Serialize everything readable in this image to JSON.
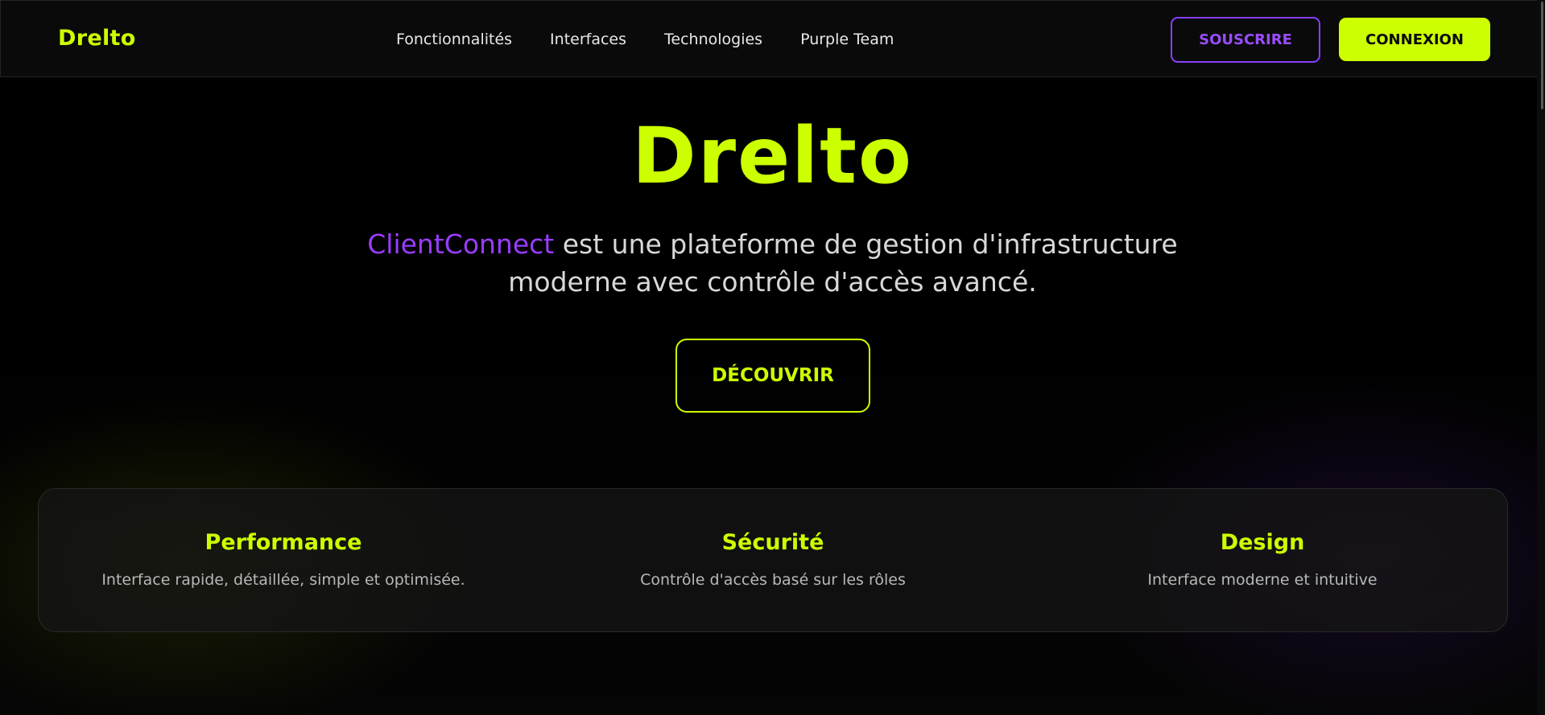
{
  "header": {
    "logo": "Drelto",
    "nav": [
      "Fonctionnalités",
      "Interfaces",
      "Technologies",
      "Purple Team"
    ],
    "subscribe_label": "SOUSCRIRE",
    "login_label": "CONNEXION"
  },
  "hero": {
    "title": "Drelto",
    "brand": "ClientConnect",
    "tagline": " est une plateforme de gestion d'infrastructure moderne avec contrôle d'accès avancé.",
    "cta_label": "DÉCOUVRIR"
  },
  "features": [
    {
      "title": "Performance",
      "description": "Interface rapide, détaillée, simple et optimisée."
    },
    {
      "title": "Sécurité",
      "description": "Contrôle d'accès basé sur les rôles"
    },
    {
      "title": "Design",
      "description": "Interface moderne et intuitive"
    }
  ],
  "colors": {
    "accent": "#ccff00",
    "purple": "#9a3cff",
    "background": "#000000"
  }
}
